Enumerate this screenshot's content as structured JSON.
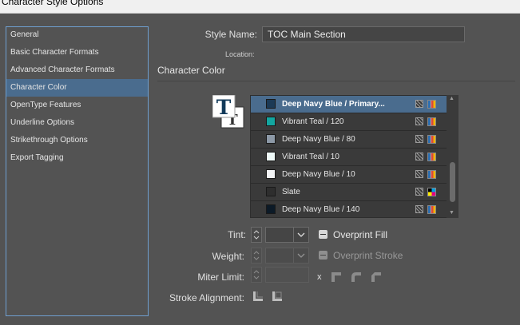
{
  "window": {
    "title": "Character Style Options"
  },
  "sidebar": {
    "items": [
      {
        "label": "General",
        "selected": false
      },
      {
        "label": "Basic Character Formats",
        "selected": false
      },
      {
        "label": "Advanced Character Formats",
        "selected": false
      },
      {
        "label": "Character Color",
        "selected": true
      },
      {
        "label": "OpenType Features",
        "selected": false
      },
      {
        "label": "Underline Options",
        "selected": false
      },
      {
        "label": "Strikethrough Options",
        "selected": false
      },
      {
        "label": "Export Tagging",
        "selected": false
      }
    ]
  },
  "form": {
    "style_name_label": "Style Name:",
    "style_name_value": "TOC Main Section",
    "location_label": "Location:",
    "section_title": "Character Color"
  },
  "swatches": [
    {
      "name": "Deep Navy Blue / Primary...",
      "color": "#1c3a56",
      "selected": true,
      "mode": "cmyk"
    },
    {
      "name": "Vibrant Teal / 120",
      "color": "#13a6a0",
      "selected": false,
      "mode": "cmyk"
    },
    {
      "name": "Deep Navy Blue / 80",
      "color": "#8d99a7",
      "selected": false,
      "mode": "cmyk"
    },
    {
      "name": "Vibrant Teal / 10",
      "color": "#eef9f8",
      "selected": false,
      "mode": "cmyk"
    },
    {
      "name": "Deep Navy Blue / 10",
      "color": "#f3f4f6",
      "selected": false,
      "mode": "cmyk"
    },
    {
      "name": "Slate",
      "color": "#2e2e2e",
      "selected": false,
      "mode": "process"
    },
    {
      "name": "Deep Navy Blue / 140",
      "color": "#0c1a27",
      "selected": false,
      "mode": "cmyk"
    }
  ],
  "controls": {
    "tint_label": "Tint:",
    "tint_value": "",
    "overprint_fill_label": "Overprint Fill",
    "weight_label": "Weight:",
    "weight_value": "",
    "overprint_stroke_label": "Overprint Stroke",
    "miter_label": "Miter Limit:",
    "miter_value": "",
    "x_label": "x",
    "stroke_alignment_label": "Stroke Alignment:"
  },
  "icons": {
    "selected_text_icon": "T"
  }
}
